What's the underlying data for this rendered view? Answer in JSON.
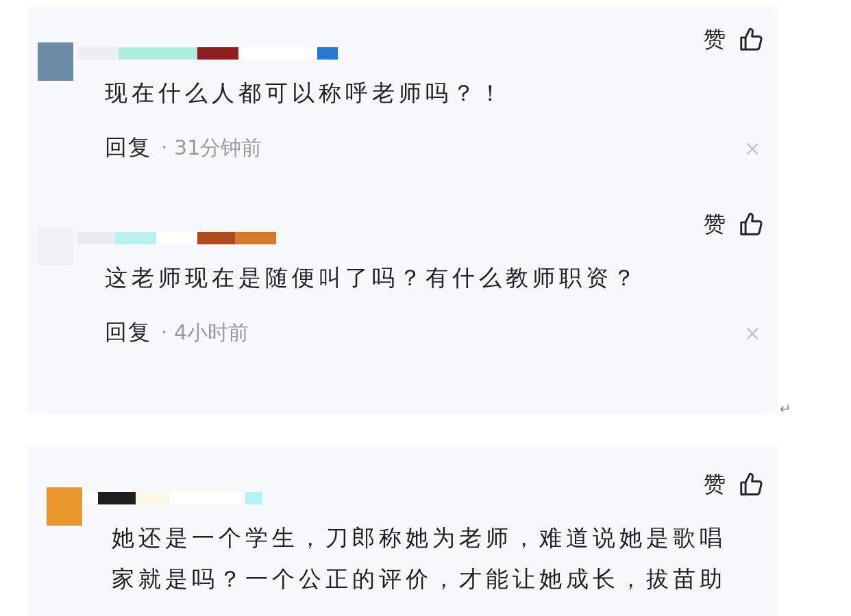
{
  "groups": [
    {
      "comments": [
        {
          "color": "#6b8ba4",
          "like_label": "赞",
          "text": "现在什么人都可以称呼老师吗？！",
          "reply_label": "回复",
          "time": "· 31分钟前",
          "close": "×"
        },
        {
          "color": "#eef0f4",
          "like_label": "赞",
          "text": "这老师现在是随便叫了吗？有什么教师职资？",
          "reply_label": "回复",
          "time": "· 4小时前",
          "close": "×"
        }
      ]
    },
    {
      "comments": [
        {
          "color": "#e8962a",
          "like_label": "赞",
          "text": "她还是一个学生，刀郎称她为老师，难道说她是歌唱家就是吗？一个公正的评价，才能让她成长，拔苗助"
        }
      ]
    }
  ],
  "return_mark": "↵"
}
